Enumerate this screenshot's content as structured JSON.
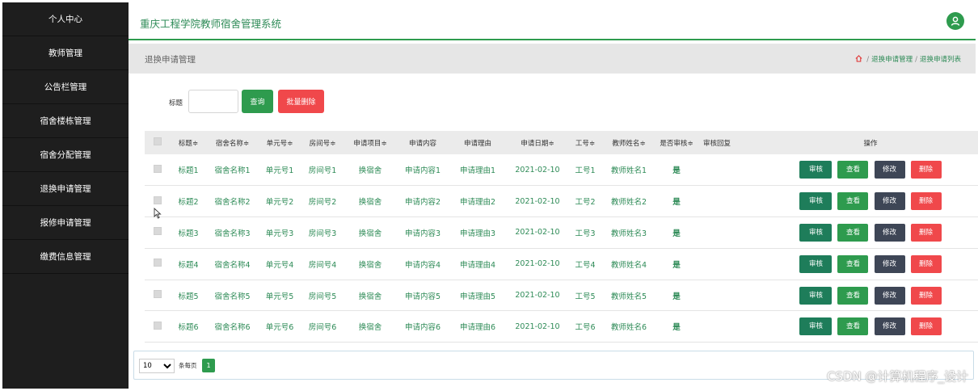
{
  "sidebar": {
    "items": [
      {
        "label": "个人中心"
      },
      {
        "label": "教师管理"
      },
      {
        "label": "公告栏管理"
      },
      {
        "label": "宿舍楼栋管理"
      },
      {
        "label": "宿舍分配管理"
      },
      {
        "label": "退换申请管理"
      },
      {
        "label": "报修申请管理"
      },
      {
        "label": "缴费信息管理"
      }
    ]
  },
  "header": {
    "title": "重庆工程学院教师宿舍管理系统",
    "user_icon": "user-icon",
    "accent_color": "#2e9b4e"
  },
  "breadcrumb": {
    "page_title": "退换申请管理",
    "home_icon": "home-icon",
    "crumb1": "退换申请管理",
    "crumb2": "退换申请列表",
    "separator": "/"
  },
  "search": {
    "label": "标题",
    "value": "",
    "query_label": "查询",
    "batch_delete_label": "批量删除"
  },
  "table": {
    "columns": [
      "标题",
      "宿舍名称",
      "单元号",
      "房间号",
      "申请项目",
      "申请内容",
      "申请理由",
      "申请日期",
      "工号",
      "教师姓名",
      "是否审核",
      "审核回复",
      "操作"
    ],
    "sort_mark": "≑",
    "rows": [
      {
        "title": "标题1",
        "dorm": "宿舍名称1",
        "unit": "单元号1",
        "room": "房间号1",
        "item": "换宿舍",
        "content": "申请内容1",
        "reason": "申请理由1",
        "date": "2021-02-10",
        "job_no": "工号1",
        "teacher": "教师姓名1",
        "audited": "是",
        "reply": ""
      },
      {
        "title": "标题2",
        "dorm": "宿舍名称2",
        "unit": "单元号2",
        "room": "房间号2",
        "item": "换宿舍",
        "content": "申请内容2",
        "reason": "申请理由2",
        "date": "2021-02-10",
        "job_no": "工号2",
        "teacher": "教师姓名2",
        "audited": "是",
        "reply": ""
      },
      {
        "title": "标题3",
        "dorm": "宿舍名称3",
        "unit": "单元号3",
        "room": "房间号3",
        "item": "换宿舍",
        "content": "申请内容3",
        "reason": "申请理由3",
        "date": "2021-02-10",
        "job_no": "工号3",
        "teacher": "教师姓名3",
        "audited": "是",
        "reply": ""
      },
      {
        "title": "标题4",
        "dorm": "宿舍名称4",
        "unit": "单元号4",
        "room": "房间号4",
        "item": "换宿舍",
        "content": "申请内容4",
        "reason": "申请理由4",
        "date": "2021-02-10",
        "job_no": "工号4",
        "teacher": "教师姓名4",
        "audited": "是",
        "reply": ""
      },
      {
        "title": "标题5",
        "dorm": "宿舍名称5",
        "unit": "单元号5",
        "room": "房间号5",
        "item": "换宿舍",
        "content": "申请内容5",
        "reason": "申请理由5",
        "date": "2021-02-10",
        "job_no": "工号5",
        "teacher": "教师姓名5",
        "audited": "是",
        "reply": ""
      },
      {
        "title": "标题6",
        "dorm": "宿舍名称6",
        "unit": "单元号6",
        "room": "房间号6",
        "item": "换宿舍",
        "content": "申请内容6",
        "reason": "申请理由6",
        "date": "2021-02-10",
        "job_no": "工号6",
        "teacher": "教师姓名6",
        "audited": "是",
        "reply": ""
      }
    ],
    "actions": {
      "audit": "审核",
      "view": "查看",
      "edit": "修改",
      "delete": "删除"
    }
  },
  "pager": {
    "page_size": "10",
    "per_page_label": "条每页",
    "current_page": "1"
  },
  "watermark": "CSDN @计算机程序_设计"
}
